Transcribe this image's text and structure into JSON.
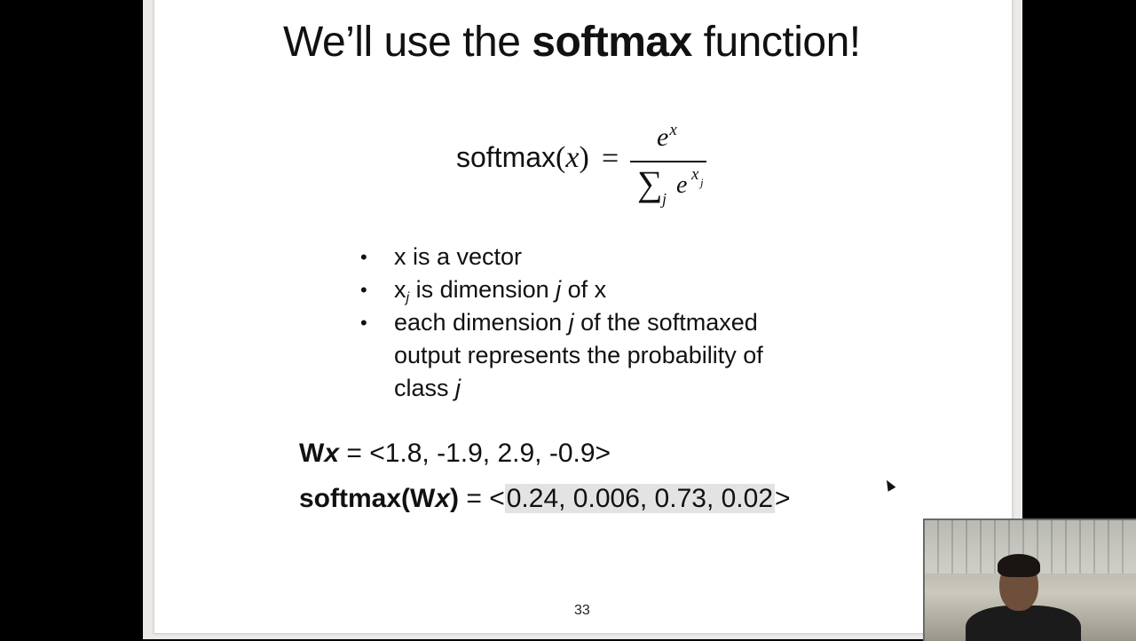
{
  "slide": {
    "title_pre": "We’ll use the ",
    "title_bold": "softmax",
    "title_post": " function!",
    "formula": {
      "lhs_text": "softmax",
      "lhs_open": "(",
      "lhs_var": "x",
      "lhs_close": ")",
      "equals": "=",
      "numerator_base": "e",
      "numerator_exp": "x",
      "sum_symbol": "∑",
      "sum_index": "j",
      "denominator_base": "e",
      "denominator_exp": "x",
      "denominator_exp_sub": "j"
    },
    "bullets": {
      "b1": "x is a vector",
      "b2_pre": "x",
      "b2_sub": "j",
      "b2_mid": " is dimension ",
      "b2_it": "j",
      "b2_post": " of x",
      "b3_pre": "each dimension ",
      "b3_it1": "j",
      "b3_mid": " of the softmaxed output represents the probability of class ",
      "b3_it2": "j",
      "dot": "•"
    },
    "wx_line": {
      "label_w": "W",
      "label_x": "x",
      "rest": " = <1.8,  -1.9,  2.9,  -0.9>"
    },
    "softmax_line": {
      "label_pre": "softmax(W",
      "label_x": "x",
      "label_post": ")",
      "eq": " = <",
      "values": "0.24, 0.006,  0.73,  0.02",
      "close": ">"
    },
    "page_number": "33"
  }
}
